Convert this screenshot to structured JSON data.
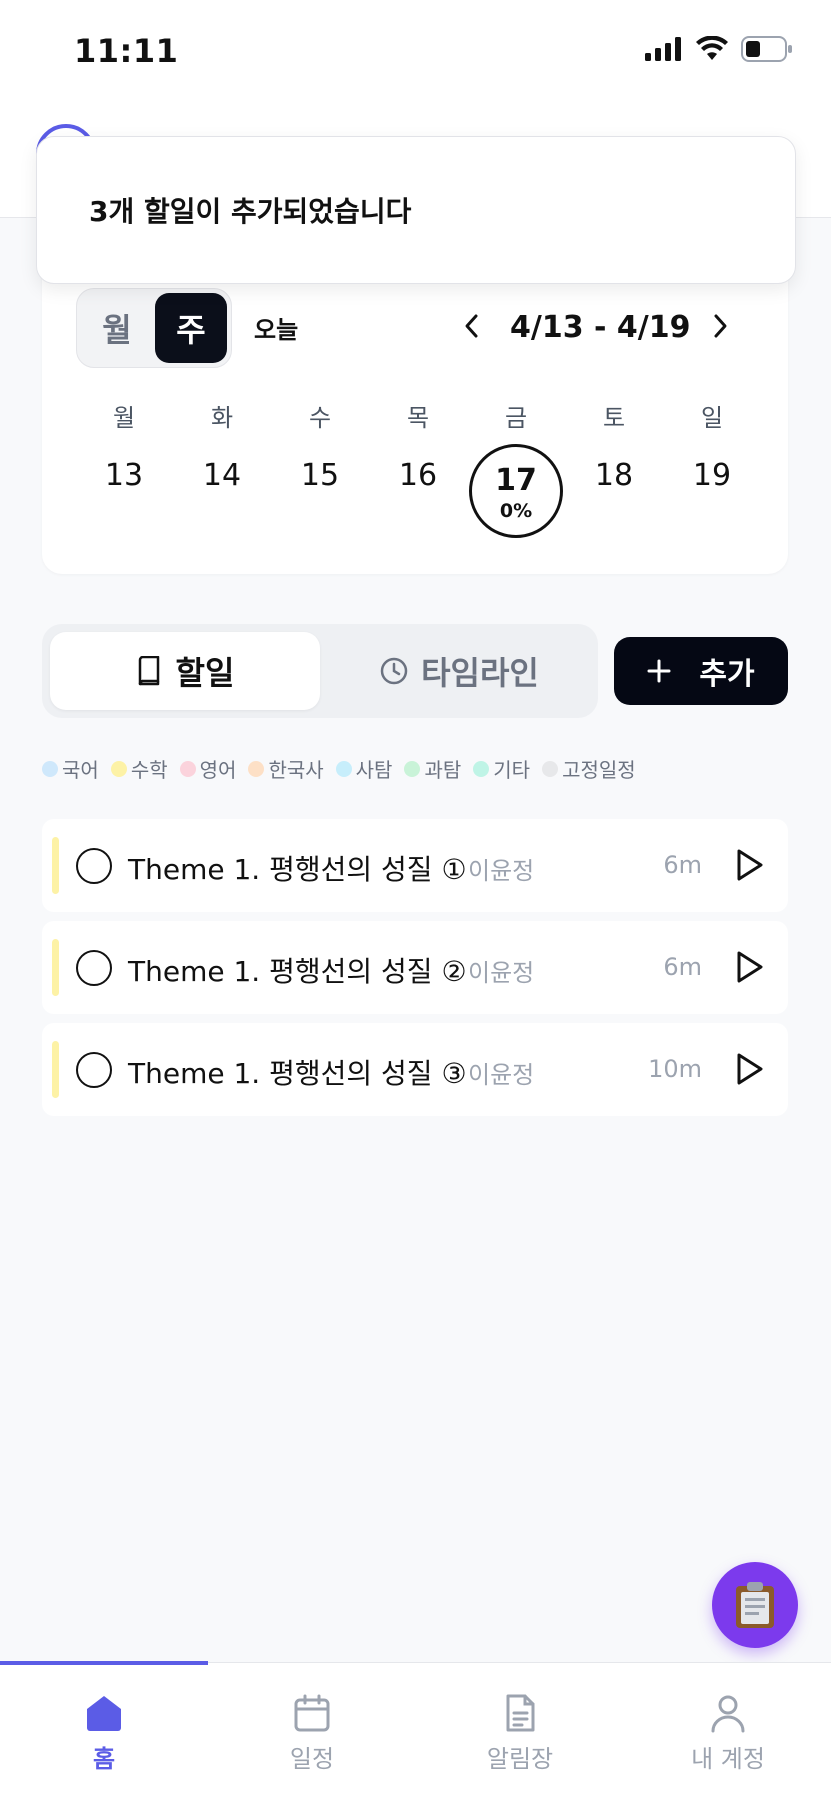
{
  "status": {
    "time": "11:11"
  },
  "toast": {
    "message": "3개 할일이 추가되었습니다"
  },
  "calendar": {
    "view_month": "월",
    "view_week": "주",
    "today": "오늘",
    "range": "4/13 - 4/19",
    "weekdays": [
      "월",
      "화",
      "수",
      "목",
      "금",
      "토",
      "일"
    ],
    "dates": [
      "13",
      "14",
      "15",
      "16",
      "17",
      "18",
      "19"
    ],
    "today_pct": "0%"
  },
  "tabs": {
    "todo": "할일",
    "timeline": "타임라인"
  },
  "add_button": {
    "label": "추가"
  },
  "legend": [
    {
      "label": "국어",
      "color": "#cfe8fb"
    },
    {
      "label": "수학",
      "color": "#fdf2a6"
    },
    {
      "label": "영어",
      "color": "#fbd3dc"
    },
    {
      "label": "한국사",
      "color": "#fde0c6"
    },
    {
      "label": "사탐",
      "color": "#c7eefb"
    },
    {
      "label": "과탐",
      "color": "#c9f3d8"
    },
    {
      "label": "기타",
      "color": "#bff4e6"
    },
    {
      "label": "고정일정",
      "color": "#e7e8ea"
    }
  ],
  "todos": [
    {
      "title": "Theme 1. 평행선의 성질 ①",
      "teacher": "이윤정",
      "duration": "6m",
      "color": "#fdf2a6"
    },
    {
      "title": "Theme 1. 평행선의 성질 ②",
      "teacher": "이윤정",
      "duration": "6m",
      "color": "#fdf2a6"
    },
    {
      "title": "Theme 1. 평행선의 성질 ③",
      "teacher": "이윤정",
      "duration": "10m",
      "color": "#fdf2a6"
    }
  ],
  "nav": {
    "home": "홈",
    "schedule": "일정",
    "notice": "알림장",
    "account": "내 계정"
  },
  "colors": {
    "accent": "#5b5ce6",
    "fab": "#7c3aed",
    "dark": "#050814"
  }
}
